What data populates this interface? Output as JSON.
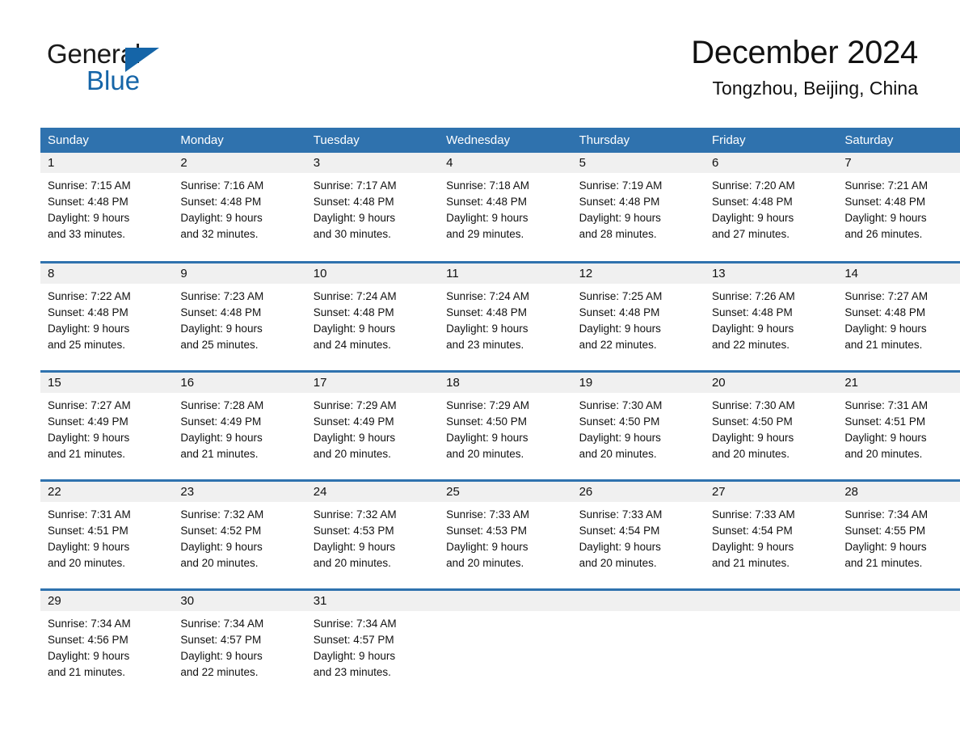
{
  "brand": {
    "name_part1": "General",
    "name_part2": "Blue",
    "triangle_color": "#1565a8"
  },
  "header": {
    "title": "December 2024",
    "subtitle": "Tongzhou, Beijing, China"
  },
  "theme": {
    "accent_blue": "#2f72ae",
    "day_band_gray": "#f0f0f0",
    "text_color": "#111111"
  },
  "weekday_headers": [
    "Sunday",
    "Monday",
    "Tuesday",
    "Wednesday",
    "Thursday",
    "Friday",
    "Saturday"
  ],
  "weeks": [
    [
      {
        "day": "1",
        "sunrise": "Sunrise: 7:15 AM",
        "sunset": "Sunset: 4:48 PM",
        "daylight_line1": "Daylight: 9 hours",
        "daylight_line2": "and 33 minutes."
      },
      {
        "day": "2",
        "sunrise": "Sunrise: 7:16 AM",
        "sunset": "Sunset: 4:48 PM",
        "daylight_line1": "Daylight: 9 hours",
        "daylight_line2": "and 32 minutes."
      },
      {
        "day": "3",
        "sunrise": "Sunrise: 7:17 AM",
        "sunset": "Sunset: 4:48 PM",
        "daylight_line1": "Daylight: 9 hours",
        "daylight_line2": "and 30 minutes."
      },
      {
        "day": "4",
        "sunrise": "Sunrise: 7:18 AM",
        "sunset": "Sunset: 4:48 PM",
        "daylight_line1": "Daylight: 9 hours",
        "daylight_line2": "and 29 minutes."
      },
      {
        "day": "5",
        "sunrise": "Sunrise: 7:19 AM",
        "sunset": "Sunset: 4:48 PM",
        "daylight_line1": "Daylight: 9 hours",
        "daylight_line2": "and 28 minutes."
      },
      {
        "day": "6",
        "sunrise": "Sunrise: 7:20 AM",
        "sunset": "Sunset: 4:48 PM",
        "daylight_line1": "Daylight: 9 hours",
        "daylight_line2": "and 27 minutes."
      },
      {
        "day": "7",
        "sunrise": "Sunrise: 7:21 AM",
        "sunset": "Sunset: 4:48 PM",
        "daylight_line1": "Daylight: 9 hours",
        "daylight_line2": "and 26 minutes."
      }
    ],
    [
      {
        "day": "8",
        "sunrise": "Sunrise: 7:22 AM",
        "sunset": "Sunset: 4:48 PM",
        "daylight_line1": "Daylight: 9 hours",
        "daylight_line2": "and 25 minutes."
      },
      {
        "day": "9",
        "sunrise": "Sunrise: 7:23 AM",
        "sunset": "Sunset: 4:48 PM",
        "daylight_line1": "Daylight: 9 hours",
        "daylight_line2": "and 25 minutes."
      },
      {
        "day": "10",
        "sunrise": "Sunrise: 7:24 AM",
        "sunset": "Sunset: 4:48 PM",
        "daylight_line1": "Daylight: 9 hours",
        "daylight_line2": "and 24 minutes."
      },
      {
        "day": "11",
        "sunrise": "Sunrise: 7:24 AM",
        "sunset": "Sunset: 4:48 PM",
        "daylight_line1": "Daylight: 9 hours",
        "daylight_line2": "and 23 minutes."
      },
      {
        "day": "12",
        "sunrise": "Sunrise: 7:25 AM",
        "sunset": "Sunset: 4:48 PM",
        "daylight_line1": "Daylight: 9 hours",
        "daylight_line2": "and 22 minutes."
      },
      {
        "day": "13",
        "sunrise": "Sunrise: 7:26 AM",
        "sunset": "Sunset: 4:48 PM",
        "daylight_line1": "Daylight: 9 hours",
        "daylight_line2": "and 22 minutes."
      },
      {
        "day": "14",
        "sunrise": "Sunrise: 7:27 AM",
        "sunset": "Sunset: 4:48 PM",
        "daylight_line1": "Daylight: 9 hours",
        "daylight_line2": "and 21 minutes."
      }
    ],
    [
      {
        "day": "15",
        "sunrise": "Sunrise: 7:27 AM",
        "sunset": "Sunset: 4:49 PM",
        "daylight_line1": "Daylight: 9 hours",
        "daylight_line2": "and 21 minutes."
      },
      {
        "day": "16",
        "sunrise": "Sunrise: 7:28 AM",
        "sunset": "Sunset: 4:49 PM",
        "daylight_line1": "Daylight: 9 hours",
        "daylight_line2": "and 21 minutes."
      },
      {
        "day": "17",
        "sunrise": "Sunrise: 7:29 AM",
        "sunset": "Sunset: 4:49 PM",
        "daylight_line1": "Daylight: 9 hours",
        "daylight_line2": "and 20 minutes."
      },
      {
        "day": "18",
        "sunrise": "Sunrise: 7:29 AM",
        "sunset": "Sunset: 4:50 PM",
        "daylight_line1": "Daylight: 9 hours",
        "daylight_line2": "and 20 minutes."
      },
      {
        "day": "19",
        "sunrise": "Sunrise: 7:30 AM",
        "sunset": "Sunset: 4:50 PM",
        "daylight_line1": "Daylight: 9 hours",
        "daylight_line2": "and 20 minutes."
      },
      {
        "day": "20",
        "sunrise": "Sunrise: 7:30 AM",
        "sunset": "Sunset: 4:50 PM",
        "daylight_line1": "Daylight: 9 hours",
        "daylight_line2": "and 20 minutes."
      },
      {
        "day": "21",
        "sunrise": "Sunrise: 7:31 AM",
        "sunset": "Sunset: 4:51 PM",
        "daylight_line1": "Daylight: 9 hours",
        "daylight_line2": "and 20 minutes."
      }
    ],
    [
      {
        "day": "22",
        "sunrise": "Sunrise: 7:31 AM",
        "sunset": "Sunset: 4:51 PM",
        "daylight_line1": "Daylight: 9 hours",
        "daylight_line2": "and 20 minutes."
      },
      {
        "day": "23",
        "sunrise": "Sunrise: 7:32 AM",
        "sunset": "Sunset: 4:52 PM",
        "daylight_line1": "Daylight: 9 hours",
        "daylight_line2": "and 20 minutes."
      },
      {
        "day": "24",
        "sunrise": "Sunrise: 7:32 AM",
        "sunset": "Sunset: 4:53 PM",
        "daylight_line1": "Daylight: 9 hours",
        "daylight_line2": "and 20 minutes."
      },
      {
        "day": "25",
        "sunrise": "Sunrise: 7:33 AM",
        "sunset": "Sunset: 4:53 PM",
        "daylight_line1": "Daylight: 9 hours",
        "daylight_line2": "and 20 minutes."
      },
      {
        "day": "26",
        "sunrise": "Sunrise: 7:33 AM",
        "sunset": "Sunset: 4:54 PM",
        "daylight_line1": "Daylight: 9 hours",
        "daylight_line2": "and 20 minutes."
      },
      {
        "day": "27",
        "sunrise": "Sunrise: 7:33 AM",
        "sunset": "Sunset: 4:54 PM",
        "daylight_line1": "Daylight: 9 hours",
        "daylight_line2": "and 21 minutes."
      },
      {
        "day": "28",
        "sunrise": "Sunrise: 7:34 AM",
        "sunset": "Sunset: 4:55 PM",
        "daylight_line1": "Daylight: 9 hours",
        "daylight_line2": "and 21 minutes."
      }
    ],
    [
      {
        "day": "29",
        "sunrise": "Sunrise: 7:34 AM",
        "sunset": "Sunset: 4:56 PM",
        "daylight_line1": "Daylight: 9 hours",
        "daylight_line2": "and 21 minutes."
      },
      {
        "day": "30",
        "sunrise": "Sunrise: 7:34 AM",
        "sunset": "Sunset: 4:57 PM",
        "daylight_line1": "Daylight: 9 hours",
        "daylight_line2": "and 22 minutes."
      },
      {
        "day": "31",
        "sunrise": "Sunrise: 7:34 AM",
        "sunset": "Sunset: 4:57 PM",
        "daylight_line1": "Daylight: 9 hours",
        "daylight_line2": "and 23 minutes."
      },
      {
        "day": "",
        "sunrise": "",
        "sunset": "",
        "daylight_line1": "",
        "daylight_line2": ""
      },
      {
        "day": "",
        "sunrise": "",
        "sunset": "",
        "daylight_line1": "",
        "daylight_line2": ""
      },
      {
        "day": "",
        "sunrise": "",
        "sunset": "",
        "daylight_line1": "",
        "daylight_line2": ""
      },
      {
        "day": "",
        "sunrise": "",
        "sunset": "",
        "daylight_line1": "",
        "daylight_line2": ""
      }
    ]
  ]
}
